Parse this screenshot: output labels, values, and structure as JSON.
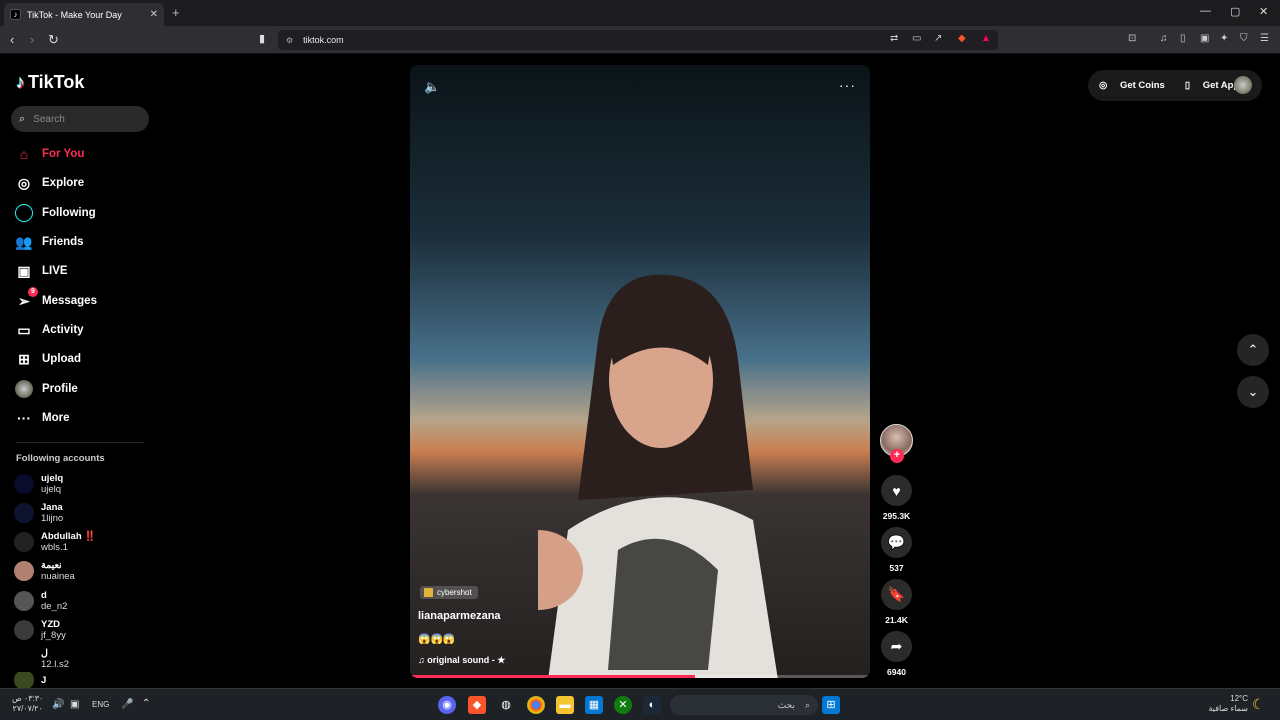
{
  "browser": {
    "tab_title": "TikTok - Make Your Day",
    "tab_close": "✕",
    "new_tab": "+",
    "url": "tiktok.com"
  },
  "sidebar": {
    "brand": "TikTok",
    "search_placeholder": "Search",
    "menu": [
      {
        "label": "For You",
        "icon": "home-icon"
      },
      {
        "label": "Explore",
        "icon": "compass-icon"
      },
      {
        "label": "Following",
        "icon": "following-icon"
      },
      {
        "label": "Friends",
        "icon": "friends-icon"
      },
      {
        "label": "LIVE",
        "icon": "live-icon"
      },
      {
        "label": "Messages",
        "icon": "messages-icon",
        "badge": "9"
      },
      {
        "label": "Activity",
        "icon": "activity-icon"
      },
      {
        "label": "Upload",
        "icon": "upload-icon"
      },
      {
        "label": "Profile",
        "icon": "profile-icon"
      },
      {
        "label": "More",
        "icon": "more-icon"
      }
    ],
    "following_title": "Following accounts",
    "accounts": [
      {
        "name": "ujelq",
        "handle": "ujelq"
      },
      {
        "name": "Jana",
        "handle": "1lijno"
      },
      {
        "name": "Abdullah ‼️",
        "handle": "wbls.1"
      },
      {
        "name": "نعيمة",
        "handle": "nuainea"
      },
      {
        "name": "d",
        "handle": "de_n2"
      },
      {
        "name": "YZD",
        "handle": "jf_8yy"
      },
      {
        "name": "ل",
        "handle": "12.l.s2"
      },
      {
        "name": "J",
        "handle": ""
      }
    ]
  },
  "video": {
    "tag": "cybershot",
    "username": "lianaparmezana",
    "caption_emojis": "😱😱😱",
    "sound": "original sound - ★",
    "progress": 0.62
  },
  "actions": {
    "likes": "295.3K",
    "comments": "537",
    "saves": "21.4K",
    "shares": "6940"
  },
  "topright": {
    "get_coins": "Get Coins",
    "get_app": "Get App"
  },
  "taskbar": {
    "time": "٠٣:٣٠ ص",
    "date": "٢٧/٠٧/٢٠",
    "lang": "ENG",
    "search": "بحث",
    "weather_temp": "12°C",
    "weather_desc": "سماء صافية"
  },
  "colors": {
    "accent": "#fe2c55",
    "bg": "#000000"
  }
}
